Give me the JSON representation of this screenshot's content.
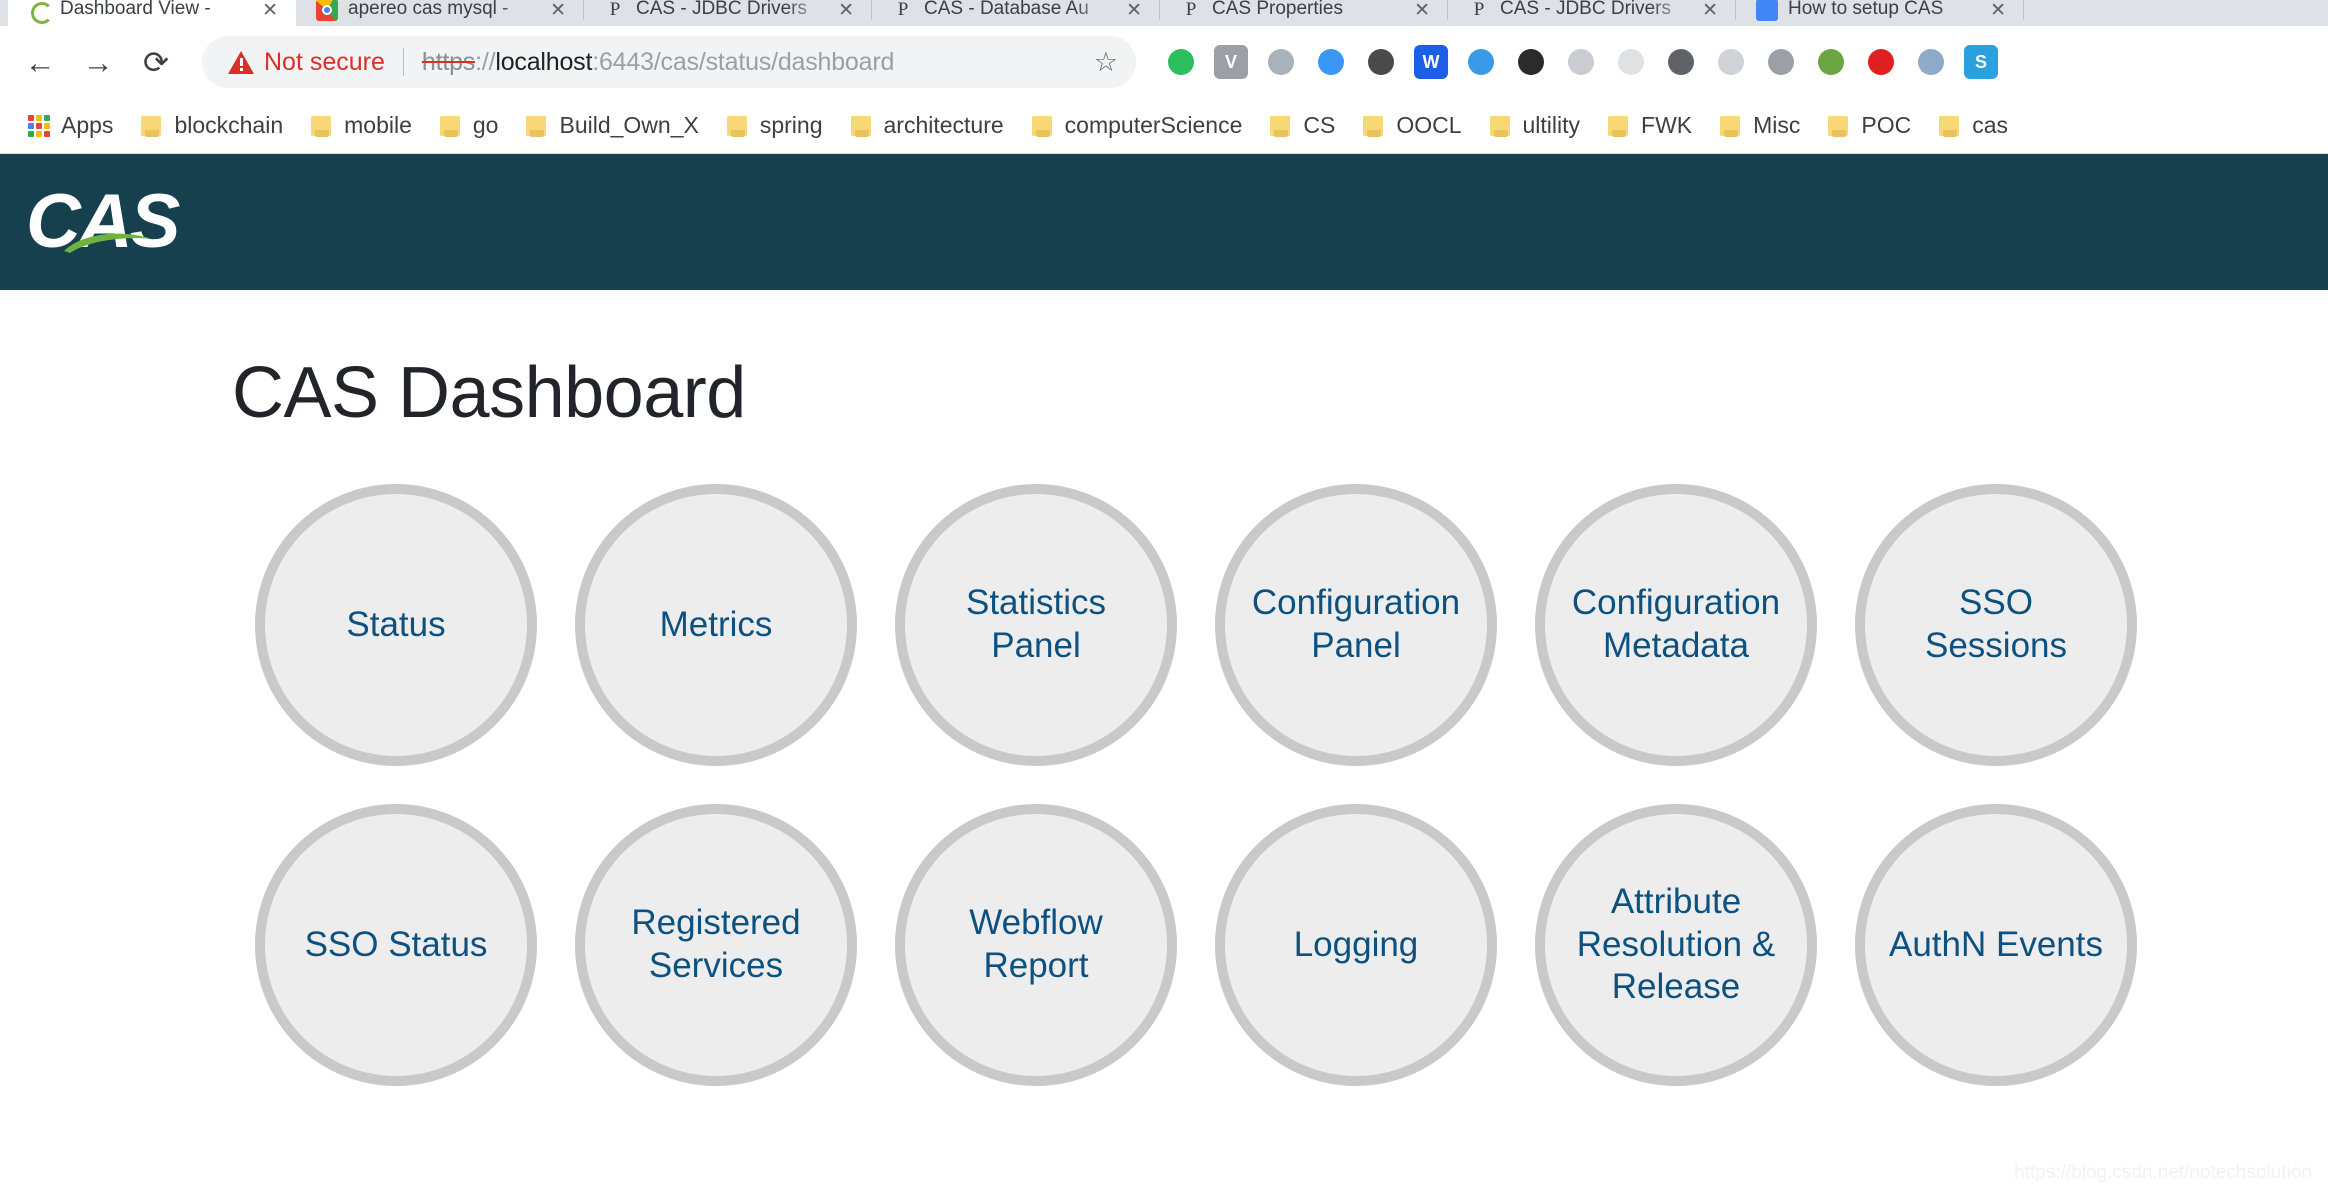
{
  "browser": {
    "tabs": [
      {
        "title": "Dashboard View -",
        "favicon": "fv-green",
        "active": true
      },
      {
        "title": "apereo cas mysql -",
        "favicon": "fv-chrome",
        "active": false
      },
      {
        "title": "CAS - JDBC Drivers",
        "favicon": "fv-doc",
        "active": false
      },
      {
        "title": "CAS - Database Au",
        "favicon": "fv-doc",
        "active": false
      },
      {
        "title": "CAS Properties",
        "favicon": "fv-doc",
        "active": false
      },
      {
        "title": "CAS - JDBC Drivers",
        "favicon": "fv-doc",
        "active": false
      },
      {
        "title": "How to setup CAS",
        "favicon": "fv-blue",
        "active": false
      }
    ],
    "tab_close_glyph": "✕",
    "nav": {
      "back": "←",
      "forward": "→",
      "reload": "⟳"
    },
    "omnibox": {
      "security_label": "Not secure",
      "scheme": "https",
      "scheme_suffix": "://",
      "host": "localhost",
      "path": ":6443/cas/status/dashboard",
      "bookmark_star": "☆"
    },
    "extensions": [
      {
        "name": "evernote-extension-icon",
        "glyph": "",
        "color": "#2dbe60"
      },
      {
        "name": "vimeo-extension-icon",
        "glyph": "V",
        "color": "#9aa0a6"
      },
      {
        "name": "gray-circle-extension-icon",
        "glyph": "",
        "color": "#a9b2b8"
      },
      {
        "name": "blue-drop-extension-icon",
        "glyph": "",
        "color": "#3a97f5"
      },
      {
        "name": "pocket-shield-extension-icon",
        "glyph": "",
        "color": "#4a4a4a"
      },
      {
        "name": "wunderlist-extension-icon",
        "glyph": "W",
        "color": "#1b5ee8"
      },
      {
        "name": "pulse-extension-icon",
        "glyph": "",
        "color": "#3a9ae8"
      },
      {
        "name": "waveform-extension-icon",
        "glyph": "",
        "color": "#2b2b2b"
      },
      {
        "name": "sitemap-extension-icon",
        "glyph": "",
        "color": "#c9ccd0"
      },
      {
        "name": "react-extension-icon",
        "glyph": "",
        "color": "#dfe2e5"
      },
      {
        "name": "film-reel-extension-icon",
        "glyph": "",
        "color": "#5f6368"
      },
      {
        "name": "quote-extension-icon",
        "glyph": "",
        "color": "#cfd3d7"
      },
      {
        "name": "opera-extension-icon",
        "glyph": "",
        "color": "#9aa0a6"
      },
      {
        "name": "search-extension-icon",
        "glyph": "",
        "color": "#6ba644"
      },
      {
        "name": "red-badge-extension-icon",
        "glyph": "",
        "color": "#e02020"
      },
      {
        "name": "ring-extension-icon",
        "glyph": "",
        "color": "#8ea9c9"
      },
      {
        "name": "skype-extension-icon",
        "glyph": "S",
        "color": "#2aa0e0"
      }
    ],
    "bookmarks": [
      {
        "label": "Apps",
        "icon": "apps-grid"
      },
      {
        "label": "blockchain",
        "icon": "folder"
      },
      {
        "label": "mobile",
        "icon": "folder"
      },
      {
        "label": "go",
        "icon": "folder"
      },
      {
        "label": "Build_Own_X",
        "icon": "folder"
      },
      {
        "label": "spring",
        "icon": "folder"
      },
      {
        "label": "architecture",
        "icon": "folder"
      },
      {
        "label": "computerScience",
        "icon": "folder"
      },
      {
        "label": "CS",
        "icon": "folder"
      },
      {
        "label": "OOCL",
        "icon": "folder"
      },
      {
        "label": "ultility",
        "icon": "folder"
      },
      {
        "label": "FWK",
        "icon": "folder"
      },
      {
        "label": "Misc",
        "icon": "folder"
      },
      {
        "label": "POC",
        "icon": "folder"
      },
      {
        "label": "cas",
        "icon": "folder"
      }
    ]
  },
  "app": {
    "brand": "CAS",
    "header_color": "#17404f",
    "accent_color": "#0d5181",
    "tile_fill": "#ededed",
    "tile_border": "#c9c9c9",
    "title": "CAS Dashboard",
    "tiles": [
      {
        "label": "Status"
      },
      {
        "label": "Metrics"
      },
      {
        "label": "Statistics Panel"
      },
      {
        "label": "Configuration\nPanel"
      },
      {
        "label": "Configuration\nMetadata"
      },
      {
        "label": "SSO Sessions"
      },
      {
        "label": "SSO Status"
      },
      {
        "label": "Registered\nServices"
      },
      {
        "label": "Webflow\nReport"
      },
      {
        "label": "Logging"
      },
      {
        "label": "Attribute\nResolution &\nRelease"
      },
      {
        "label": "AuthN Events"
      }
    ],
    "watermark": "https://blog.csdn.net/notechsolution"
  }
}
